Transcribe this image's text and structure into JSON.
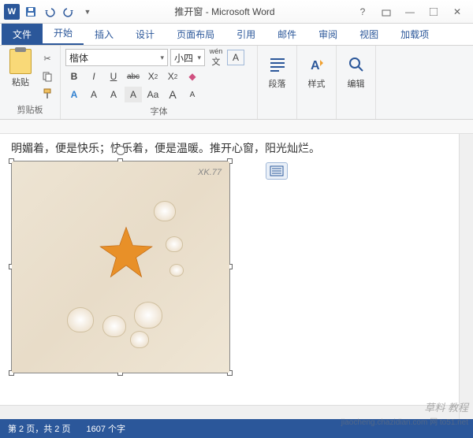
{
  "title": "推开窗 - Microsoft Word",
  "qat": {
    "word": "W"
  },
  "tabs": {
    "file": "文件",
    "home": "开始",
    "insert": "插入",
    "design": "设计",
    "layout": "页面布局",
    "references": "引用",
    "mailings": "邮件",
    "review": "审阅",
    "view": "视图",
    "addins": "加载项"
  },
  "ribbon": {
    "clipboard": {
      "paste": "粘贴",
      "label": "剪贴板"
    },
    "font": {
      "name": "楷体",
      "size": "小四",
      "phonetic": "wén",
      "label": "字体",
      "buttons": {
        "bold": "B",
        "italic": "I",
        "underline": "U",
        "strike": "abc",
        "sub": "X",
        "sup": "X",
        "effects": "A",
        "highlight": "A",
        "fontcolor": "A",
        "charshade": "A",
        "charborder": "A",
        "phoneticA": "Aa",
        "grow": "A",
        "shrink": "A"
      }
    },
    "paragraph": {
      "label": "段落"
    },
    "styles": {
      "label": "样式"
    },
    "editing": {
      "label": "编辑"
    }
  },
  "document": {
    "text": "明媚着，便是快乐；快乐着，便是温暖。推开心窗，阳光灿烂。",
    "image_watermark": "XK.77"
  },
  "status": {
    "page": "第 2 页，共 2 页",
    "words": "1607 个字"
  },
  "watermark": "草料 教程",
  "watermark2": "jiaocheng.chazidian.com  网 to51.net"
}
